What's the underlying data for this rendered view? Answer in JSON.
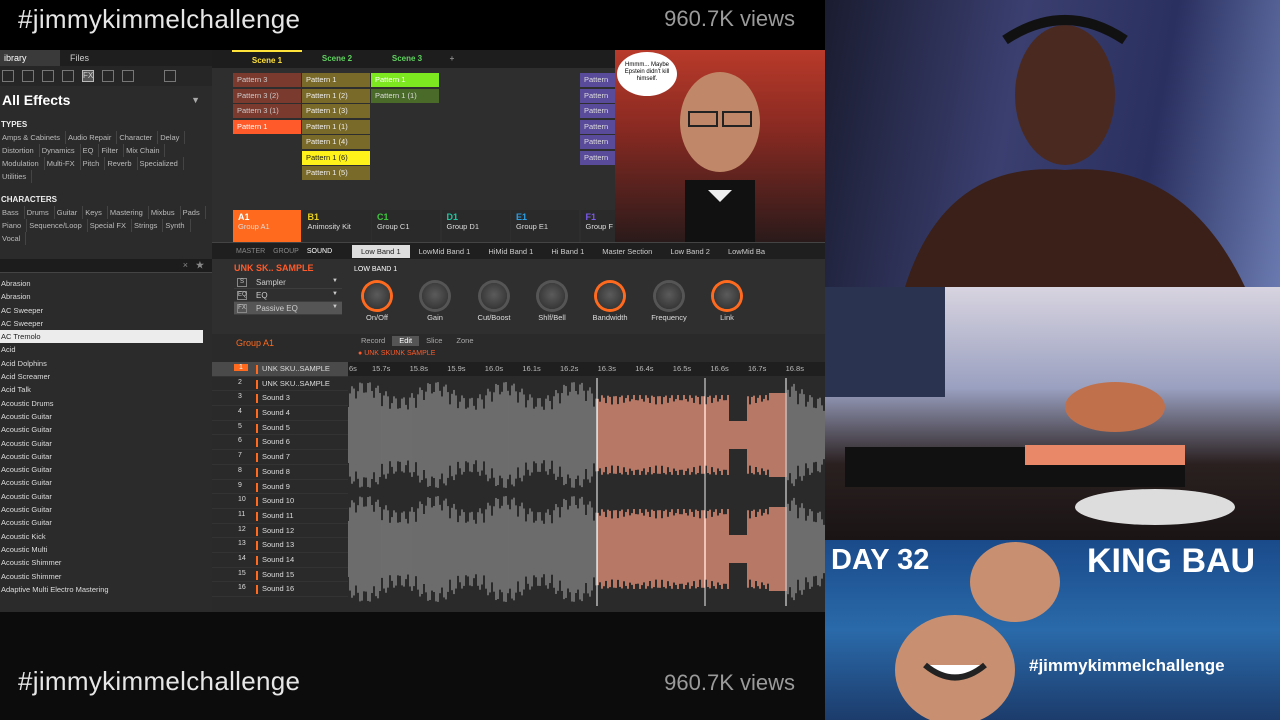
{
  "header": {
    "hashtag": "#jimmykimmelchallenge",
    "views": "960.7K views"
  },
  "browser": {
    "tabs": [
      "ibrary",
      "Files"
    ],
    "icons": [
      "clock-icon",
      "grid-icon",
      "piano-icon",
      "keys-icon",
      "FX",
      "loop-icon",
      "sample-icon",
      "upload-icon"
    ],
    "category": "All Effects",
    "types_title": "TYPES",
    "types": [
      "Amps & Cabinets",
      "Audio Repair",
      "Character",
      "Delay",
      "Distortion",
      "Dynamics",
      "EQ",
      "Filter",
      "Mix Chain",
      "Modulation",
      "Multi-FX",
      "Pitch",
      "Reverb",
      "Specialized",
      "Utilities"
    ],
    "chars_title": "CHARACTERS",
    "chars": [
      "Bass",
      "Drums",
      "Guitar",
      "Keys",
      "Mastering",
      "Mixbus",
      "Pads",
      "Piano",
      "Sequence/Loop",
      "Special FX",
      "Strings",
      "Synth",
      "Vocal"
    ],
    "results": [
      "Abrasion",
      "Abrasion",
      "AC Sweeper",
      "AC Sweeper",
      "AC Tremolo",
      "Acid",
      "Acid Dolphins",
      "Acid Screamer",
      "Acid Talk",
      "Acoustic Drums",
      "Acoustic Guitar",
      "Acoustic Guitar",
      "Acoustic Guitar",
      "Acoustic Guitar",
      "Acoustic Guitar",
      "Acoustic Guitar",
      "Acoustic Guitar",
      "Acoustic Guitar",
      "Acoustic Guitar",
      "Acoustic Kick",
      "Acoustic Multi",
      "Acoustic Shimmer",
      "Acoustic Shimmer",
      "Adaptive Multi Electro Mastering"
    ]
  },
  "arranger": {
    "scenes": [
      "Scene 1",
      "Scene 2",
      "Scene 3"
    ],
    "col1": [
      "Pattern 3",
      "Pattern 3 (2)",
      "Pattern 3 (1)",
      "Pattern 1"
    ],
    "col2": [
      "Pattern 1",
      "Pattern 1 (2)",
      "Pattern 1 (3)",
      "Pattern 1 (1)",
      "Pattern 1 (4)",
      "Pattern 1 (6)",
      "Pattern 1 (5)"
    ],
    "col3": [
      "Pattern 1",
      "Pattern 1 (1)"
    ],
    "colF": [
      "Pattern",
      "Pattern",
      "Pattern",
      "Pattern",
      "Pattern",
      "Pattern"
    ],
    "groups": [
      {
        "id": "A1",
        "name": "Group A1",
        "color": "#ff6a1e"
      },
      {
        "id": "B1",
        "name": "Animosity Kit",
        "color": "#e8d020"
      },
      {
        "id": "C1",
        "name": "Group C1",
        "color": "#3ec83e"
      },
      {
        "id": "D1",
        "name": "Group D1",
        "color": "#1ec8a0"
      },
      {
        "id": "E1",
        "name": "Group E1",
        "color": "#2aa0e8"
      },
      {
        "id": "F1",
        "name": "Group F",
        "color": "#7a5ae8"
      }
    ]
  },
  "panel": {
    "modes": [
      "MASTER",
      "GROUP",
      "SOUND"
    ],
    "bands": [
      "Low Band 1",
      "LowMid Band 1",
      "HiMid Band 1",
      "Hi Band 1",
      "Master Section",
      "Low Band 2",
      "LowMid Ba"
    ],
    "sound_title": "UNK SK.. SAMPLE",
    "plugins": [
      "Sampler",
      "EQ",
      "Passive EQ"
    ],
    "band_label": "LOW BAND 1",
    "knobs": [
      "On/Off",
      "Gain",
      "Cut/Boost",
      "Shlf/Bell",
      "Bandwidth",
      "Frequency",
      "Link"
    ]
  },
  "sounds": {
    "group": "Group A1",
    "list": [
      "UNK SKU..SAMPLE",
      "UNK SKU..SAMPLE",
      "Sound 3",
      "Sound 4",
      "Sound 5",
      "Sound 6",
      "Sound 7",
      "Sound 8",
      "Sound 9",
      "Sound 10",
      "Sound 11",
      "Sound 12",
      "Sound 13",
      "Sound 14",
      "Sound 15",
      "Sound 16"
    ]
  },
  "editor": {
    "tabs": [
      "Record",
      "Edit",
      "Slice",
      "Zone"
    ],
    "sample": "UNK SKUNK SAMPLE",
    "ruler": [
      "6s",
      "15.7s",
      "15.8s",
      "15.9s",
      "16.0s",
      "16.1s",
      "16.2s",
      "16.3s",
      "16.4s",
      "16.5s",
      "16.6s",
      "16.7s",
      "16.8s"
    ]
  },
  "meme_text": "Hmmm... Maybe Epstein didn't kill himself.",
  "banner": {
    "day": "DAY 32",
    "name": "KING BAU",
    "hashtag": "#jimmykimmelchallenge"
  }
}
